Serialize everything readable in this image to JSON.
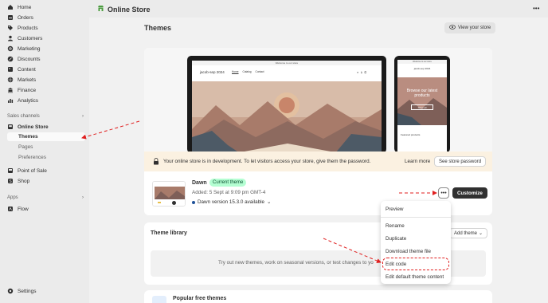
{
  "app": {
    "title": "Online Store",
    "more_label": "•••"
  },
  "sidebar": {
    "items": [
      {
        "label": "Home",
        "icon": "home-icon"
      },
      {
        "label": "Orders",
        "icon": "orders-icon"
      },
      {
        "label": "Products",
        "icon": "tag-icon"
      },
      {
        "label": "Customers",
        "icon": "person-icon"
      },
      {
        "label": "Marketing",
        "icon": "target-icon"
      },
      {
        "label": "Discounts",
        "icon": "discount-icon"
      },
      {
        "label": "Content",
        "icon": "content-icon"
      },
      {
        "label": "Markets",
        "icon": "globe-icon"
      },
      {
        "label": "Finance",
        "icon": "bank-icon"
      },
      {
        "label": "Analytics",
        "icon": "chart-icon"
      }
    ],
    "sales_channels_label": "Sales channels",
    "online_store": "Online Store",
    "sub_items": [
      "Themes",
      "Pages",
      "Preferences"
    ],
    "point_of_sale": "Point of Sale",
    "shop": "Shop",
    "apps_label": "Apps",
    "flow": "Flow",
    "settings": "Settings"
  },
  "page": {
    "title": "Themes",
    "view_store": "View your store"
  },
  "preview": {
    "desktop_banner": "Welcome to our store",
    "desktop_brand": "jacob-sep 2024",
    "desktop_nav": [
      "Home",
      "Catalog",
      "Contact"
    ],
    "mobile_banner": "Welcome to our store",
    "mobile_brand": "jacob-sep 2024",
    "mobile_headline": "Browse our latest products",
    "mobile_button": "Shop all",
    "mobile_section": "Featured products"
  },
  "banner": {
    "text": "Your online store is in development. To let visitors access your store, give them the password.",
    "learn_more": "Learn more",
    "see_password": "See store password"
  },
  "current_theme": {
    "name": "Dawn",
    "badge": "Current theme",
    "added": "Added: 5 Sept at 9:09 pm GMT-4",
    "version": "Dawn version 15.3.0 available",
    "more": "•••",
    "customize": "Customize"
  },
  "library": {
    "title": "Theme library",
    "add_theme": "Add theme",
    "empty_text": "Try out new themes, work on seasonal versions, or test changes to yo"
  },
  "popular": {
    "title": "Popular free themes"
  },
  "menu": {
    "items": [
      "Preview",
      "Rename",
      "Duplicate",
      "Download theme file",
      "Edit code",
      "Edit default theme content"
    ],
    "highlighted": "Edit code"
  },
  "colors": {
    "annotation": "#e01e1e",
    "badge_bg": "#b4fed2",
    "primary_btn": "#303030",
    "banner_bg": "#fbf1e1"
  }
}
